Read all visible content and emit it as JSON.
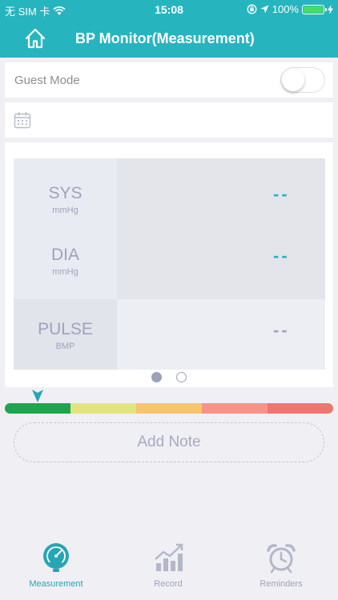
{
  "status_bar": {
    "carrier": "无 SIM 卡",
    "time": "15:08",
    "battery": "100%"
  },
  "header": {
    "title": "BP Monitor(Measurement)"
  },
  "guest_mode": {
    "label": "Guest Mode",
    "enabled": false
  },
  "measurement": {
    "sys": {
      "name": "SYS",
      "unit": "mmHg",
      "value": "--"
    },
    "dia": {
      "name": "DIA",
      "unit": "mmHg",
      "value": "--"
    },
    "pulse": {
      "name": "PULSE",
      "unit": "BMP",
      "value": "--"
    }
  },
  "pager": {
    "count": 2,
    "active_index": 0
  },
  "scale": {
    "colors": [
      "#1fa44f",
      "#e2e57e",
      "#f6c46d",
      "#f7928a",
      "#ef766f"
    ],
    "indicator_position": 0.1,
    "indicator_color": "#26a6b5"
  },
  "add_note": {
    "label": "Add Note"
  },
  "tabbar": {
    "tabs": [
      {
        "label": "Measurement",
        "icon": "gauge-icon",
        "active": true
      },
      {
        "label": "Record",
        "icon": "chart-icon",
        "active": false
      },
      {
        "label": "Reminders",
        "icon": "alarm-clock-icon",
        "active": false
      }
    ],
    "active_color": "#26a6b5",
    "inactive_color": "#9ea3bd"
  },
  "colors": {
    "accent": "#26b5bf",
    "background": "#efeff4"
  }
}
